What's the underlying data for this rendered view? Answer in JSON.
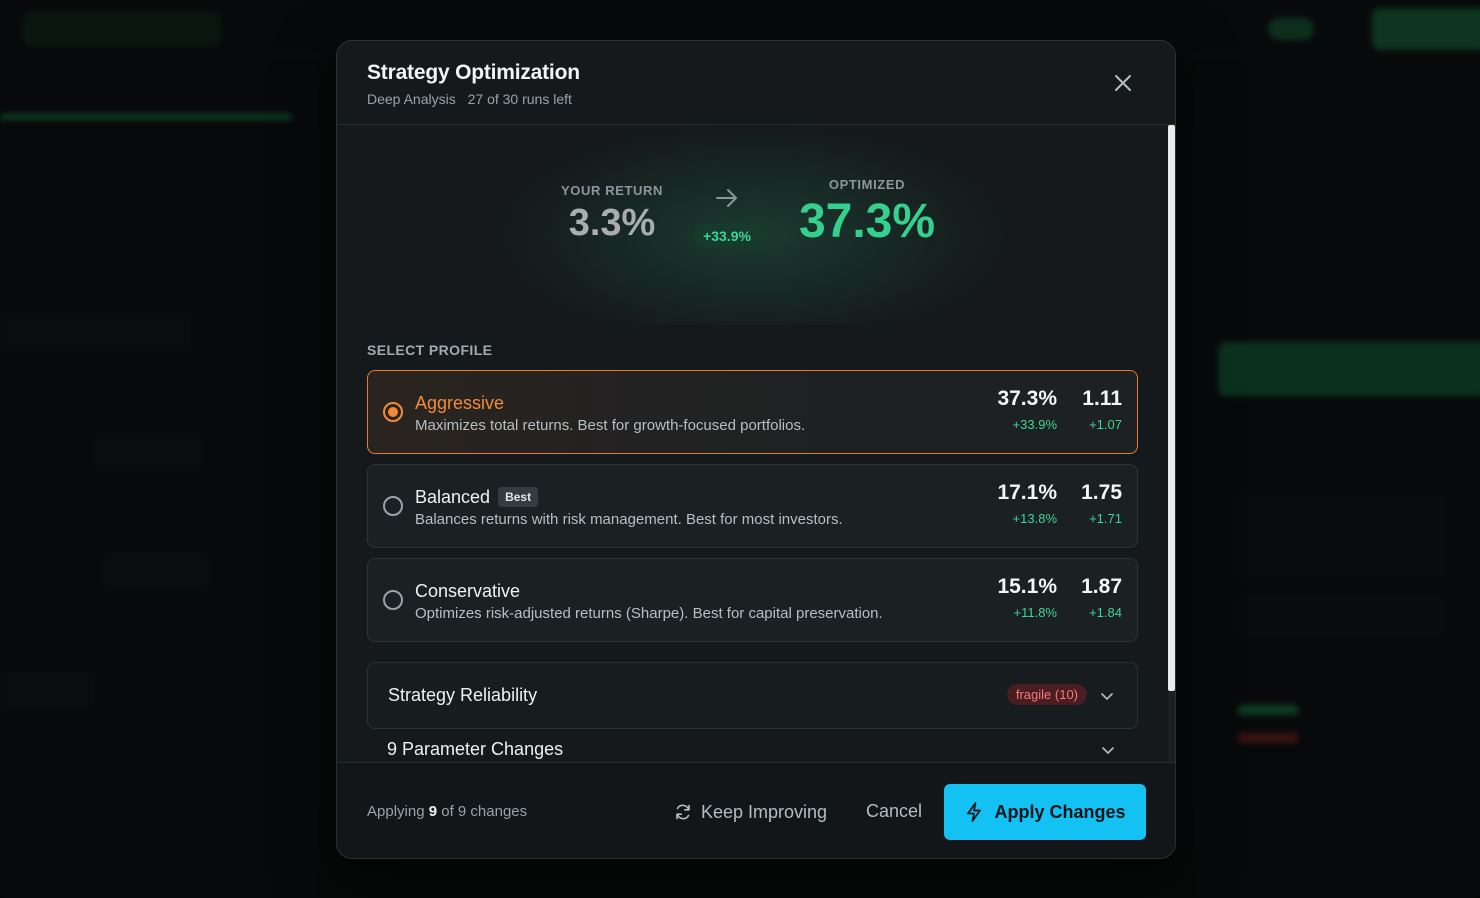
{
  "modal": {
    "title": "Strategy Optimization",
    "mode": "Deep Analysis",
    "runs_left": "27 of 30 runs left"
  },
  "hero": {
    "your_return_label": "YOUR RETURN",
    "your_return_value": "3.3%",
    "delta": "+33.9%",
    "optimized_label": "OPTIMIZED",
    "optimized_value": "37.3%"
  },
  "select_profile_label": "SELECT PROFILE",
  "profiles": [
    {
      "name": "Aggressive",
      "description": "Maximizes total returns. Best for growth-focused portfolios.",
      "return_value": "37.3%",
      "return_delta": "+33.9%",
      "sharpe_value": "1.11",
      "sharpe_delta": "+1.07",
      "selected": true
    },
    {
      "name": "Balanced",
      "badge": "Best",
      "description": "Balances returns with risk management. Best for most investors.",
      "return_value": "17.1%",
      "return_delta": "+13.8%",
      "sharpe_value": "1.75",
      "sharpe_delta": "+1.71",
      "selected": false
    },
    {
      "name": "Conservative",
      "description": "Optimizes risk-adjusted returns (Sharpe). Best for capital preservation.",
      "return_value": "15.1%",
      "return_delta": "+11.8%",
      "sharpe_value": "1.87",
      "sharpe_delta": "+1.84",
      "selected": false
    }
  ],
  "reliability": {
    "title": "Strategy Reliability",
    "badge": "fragile (10)",
    "badge_color": "#f37b7b"
  },
  "parameters": {
    "title": "9 Parameter Changes"
  },
  "footer": {
    "applying_prefix": "Applying",
    "applying_count": "9",
    "applying_suffix": "of 9 changes",
    "keep_improving": "Keep Improving",
    "cancel": "Cancel",
    "apply": "Apply Changes",
    "apply_color": "#13c1f2"
  },
  "colors": {
    "accent_orange": "#f28a3a",
    "positive_green": "#3ed597",
    "optimized_green": "#35d08e"
  }
}
